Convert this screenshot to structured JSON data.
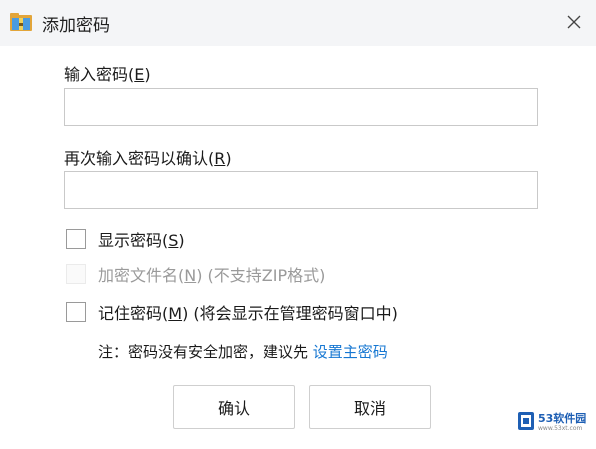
{
  "window": {
    "title": "添加密码",
    "app_icon": "archive-folder-icon",
    "close_icon": "close-icon"
  },
  "password_field": {
    "label_pre": "输入密码(",
    "label_key": "E",
    "label_post": ")",
    "value": ""
  },
  "confirm_field": {
    "label_pre": "再次输入密码以确认(",
    "label_key": "R",
    "label_post": ")",
    "value": ""
  },
  "options": {
    "show_password": {
      "pre": "显示密码(",
      "key": "S",
      "post": ")",
      "checked": false,
      "enabled": true
    },
    "encrypt_filename": {
      "pre": "加密文件名(",
      "key": "N",
      "post": ") (不支持ZIP格式)",
      "checked": false,
      "enabled": false
    },
    "remember_password": {
      "pre": "记住密码(",
      "key": "M",
      "post": ") (将会显示在管理密码窗口中)",
      "checked": false,
      "enabled": true
    }
  },
  "note": {
    "text": "注：密码没有安全加密，建议先 ",
    "link": "设置主密码"
  },
  "buttons": {
    "ok": "确认",
    "cancel": "取消"
  },
  "watermark": {
    "brand": "53软件园",
    "sub": "www.53xt.com"
  },
  "colors": {
    "titlebar": "#f4f5f7",
    "link": "#1677d2",
    "border": "#c9c9c9"
  }
}
